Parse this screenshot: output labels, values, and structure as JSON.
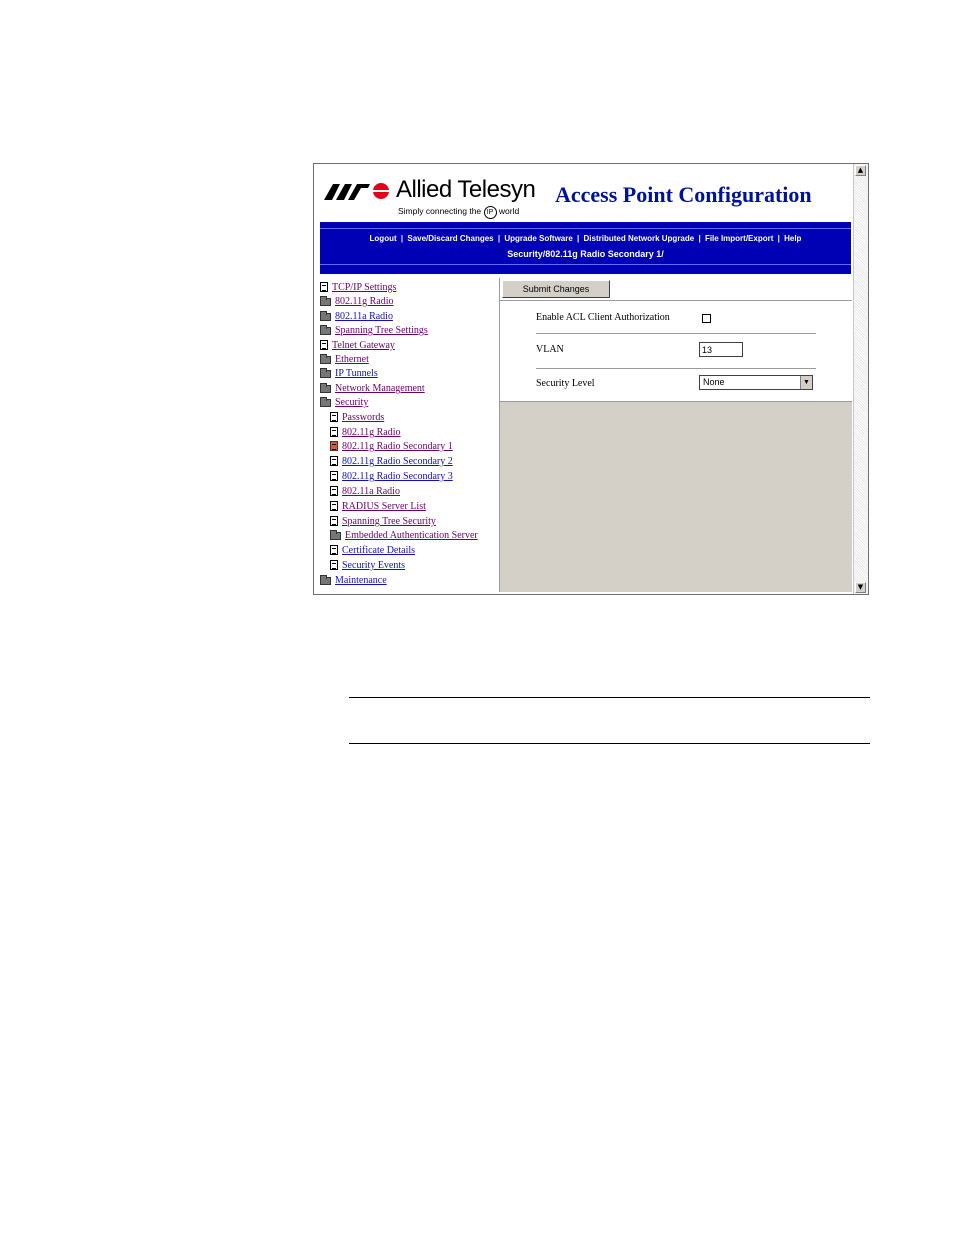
{
  "brand": {
    "name": "Allied Telesyn",
    "tagline_pre": "Simply connecting the",
    "tagline_ip": "IP",
    "tagline_post": "world"
  },
  "header": {
    "title": "Access Point Configuration"
  },
  "nav": {
    "items": [
      "Logout",
      "Save/Discard Changes",
      "Upgrade Software",
      "Distributed Network Upgrade",
      "File Import/Export",
      "Help"
    ],
    "separator": "|"
  },
  "breadcrumb": "Security/802.11g Radio Secondary 1/",
  "sidebar": {
    "items": [
      {
        "label": "TCP/IP Settings",
        "icon": "document-icon"
      },
      {
        "label": "802.11g Radio",
        "icon": "folder-icon"
      },
      {
        "label": "802.11a Radio",
        "icon": "folder-icon"
      },
      {
        "label": "Spanning Tree Settings",
        "icon": "folder-icon"
      },
      {
        "label": "Telnet Gateway",
        "icon": "document-icon"
      },
      {
        "label": "Ethernet",
        "icon": "folder-icon"
      },
      {
        "label": "IP Tunnels",
        "icon": "folder-icon"
      },
      {
        "label": "Network Management",
        "icon": "folder-icon"
      },
      {
        "label": "Security",
        "icon": "open-folder-icon"
      },
      {
        "label": "Passwords",
        "icon": "document-icon"
      },
      {
        "label": "802.11g Radio",
        "icon": "document-icon"
      },
      {
        "label": "802.11g Radio Secondary 1",
        "icon": "document-icon",
        "selected": true
      },
      {
        "label": "802.11g Radio Secondary 2",
        "icon": "document-icon"
      },
      {
        "label": "802.11g Radio Secondary 3",
        "icon": "document-icon"
      },
      {
        "label": "802.11a Radio",
        "icon": "document-icon"
      },
      {
        "label": "RADIUS Server List",
        "icon": "document-icon"
      },
      {
        "label": "Spanning Tree Security",
        "icon": "document-icon"
      },
      {
        "label": "Embedded Authentication Server",
        "icon": "folder-icon"
      },
      {
        "label": "Certificate Details",
        "icon": "document-icon"
      },
      {
        "label": "Security Events",
        "icon": "document-icon"
      },
      {
        "label": "Maintenance",
        "icon": "folder-icon"
      }
    ]
  },
  "main": {
    "submit_label": "Submit Changes",
    "acl_label": "Enable ACL Client Authorization",
    "acl_checked": false,
    "vlan_label": "VLAN",
    "vlan_value": "13",
    "security_level_label": "Security Level",
    "security_level_value": "None"
  },
  "colors": {
    "banner_blue": "#0000b5",
    "title_blue": "#00119b",
    "link_visited": "#6b006b",
    "link_blue": "#1010c0",
    "panel_gray": "#d4d0c8",
    "logo_red": "#e2001a"
  }
}
